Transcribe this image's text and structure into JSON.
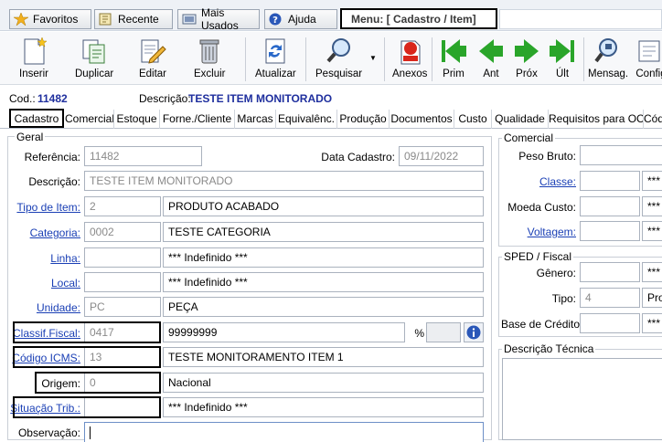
{
  "quickbar": {
    "favoritos": "Favoritos",
    "recente": "Recente",
    "mais_usados": "Mais Usados",
    "ajuda": "Ajuda",
    "menu": "Menu: [ Cadastro / Item]"
  },
  "toolbar": {
    "inserir": "Inserir",
    "duplicar": "Duplicar",
    "editar": "Editar",
    "excluir": "Excluir",
    "atualizar": "Atualizar",
    "pesquisar": "Pesquisar",
    "anexos": "Anexos",
    "prim": "Prim",
    "ant": "Ant",
    "prox": "Próx",
    "ult": "Últ",
    "mensag": "Mensag.",
    "config": "Config"
  },
  "info": {
    "cod_label": "Cod.:",
    "cod_value": "11482",
    "desc_label": "Descrição:",
    "desc_value": "TESTE ITEM MONITORADO"
  },
  "tabs": [
    "Cadastro",
    "Comercial",
    "Estoque",
    "Forne./Cliente",
    "Marcas",
    "Equivalênc.",
    "Produção",
    "Documentos",
    "Custo",
    "Qualidade",
    "Requisitos para OC",
    "Cód"
  ],
  "geral": {
    "title": "Geral",
    "referencia_label": "Referência:",
    "referencia": "11482",
    "data_cadastro_label": "Data Cadastro:",
    "data_cadastro": "09/11/2022",
    "descricao_label": "Descrição:",
    "descricao": "TESTE ITEM MONITORADO",
    "tipo_label": "Tipo de Item:",
    "tipo_code": "2",
    "tipo_desc": "PRODUTO ACABADO",
    "categoria_label": "Categoria:",
    "categoria_code": "0002",
    "categoria_desc": "TESTE CATEGORIA",
    "linha_label": "Linha:",
    "linha_code": "",
    "linha_desc": "*** Indefinido ***",
    "local_label": "Local:",
    "local_code": "",
    "local_desc": "*** Indefinido ***",
    "unidade_label": "Unidade:",
    "unidade_code": "PC",
    "unidade_desc": "PEÇA",
    "classif_label": "Classif.Fiscal:",
    "classif_code": "0417",
    "classif_desc": "99999999",
    "pct_label": "%",
    "icms_label": "Código ICMS:",
    "icms_code": "13",
    "icms_desc": "TESTE MONITORAMENTO ITEM 1",
    "origem_label": "Origem:",
    "origem_code": "0",
    "origem_desc": "Nacional",
    "situacao_label": "Situação Trib.:",
    "situacao_code": "",
    "situacao_desc": "*** Indefinido ***",
    "obs_label": "Observação:"
  },
  "comercial": {
    "title": "Comercial",
    "peso_label": "Peso Bruto:",
    "classe_label": "Classe:",
    "classe_desc": "***",
    "moeda_label": "Moeda Custo:",
    "moeda_desc": "***",
    "voltagem_label": "Voltagem:",
    "voltagem_desc": "***"
  },
  "sped": {
    "title": "SPED / Fiscal",
    "genero_label": "Gênero:",
    "genero_desc": "***",
    "tipo_label": "Tipo:",
    "tipo_code": "4",
    "tipo_desc": "Prod",
    "base_label": "Base de Crédito:",
    "base_desc": "***"
  },
  "desc_tecnica": {
    "title": "Descrição Técnica"
  },
  "colors": {
    "link": "#1a3fb5",
    "value_blue": "#1f2f9e",
    "arrow_green": "#2aa52a"
  }
}
